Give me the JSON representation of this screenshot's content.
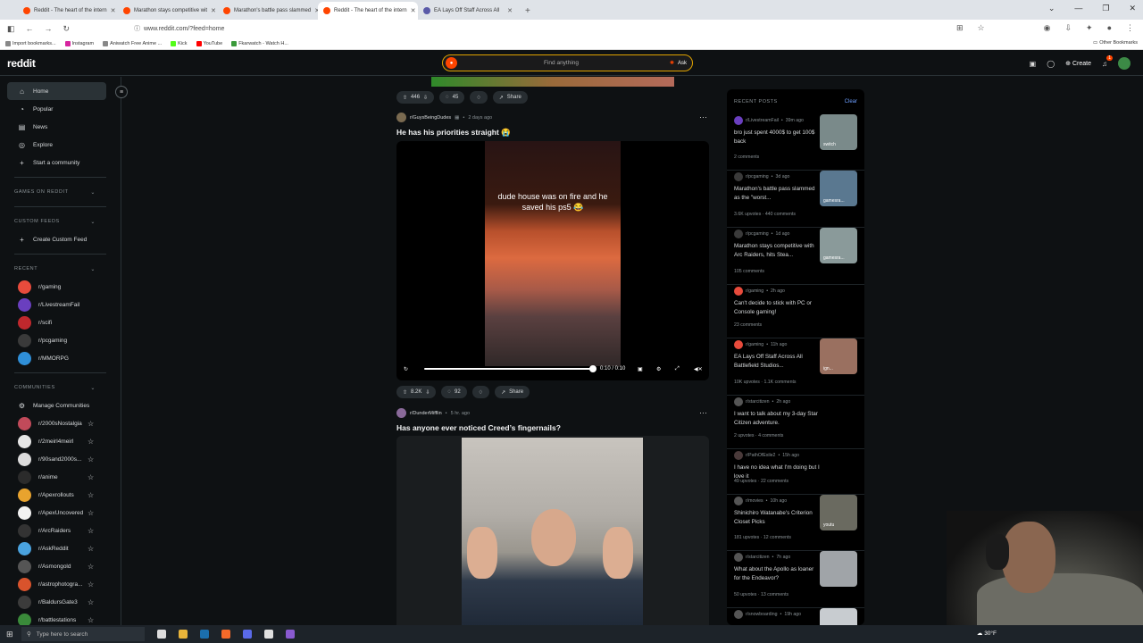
{
  "browser": {
    "tabs": [
      {
        "title": "Reddit - The heart of the intern",
        "active": false
      },
      {
        "title": "Marathon stays competitive wit",
        "active": false
      },
      {
        "title": "Marathon's battle pass slammed",
        "active": false
      },
      {
        "title": "Reddit - The heart of the intern",
        "active": true
      },
      {
        "title": "EA Lays Off Staff Across All",
        "active": false
      }
    ],
    "url_domain": "www.reddit.com",
    "url_path": "/?feed=home",
    "bookmarks": [
      "Import bookmarks...",
      "Instagram",
      "Aniwatch Free Anime ...",
      "Kick",
      "YouTube",
      "Fkarwatch - Watch H..."
    ],
    "other_bookmarks": "Other Bookmarks"
  },
  "header": {
    "logo": "reddit",
    "search_placeholder": "Find anything",
    "ask_label": "Ask",
    "create_label": "Create",
    "notif_count": "1"
  },
  "sidebar": {
    "nav": [
      {
        "label": "Home",
        "icon": "home-icon",
        "active": true
      },
      {
        "label": "Popular",
        "icon": "popular-icon"
      },
      {
        "label": "News",
        "icon": "news-icon"
      },
      {
        "label": "Explore",
        "icon": "explore-icon"
      },
      {
        "label": "Start a community",
        "icon": "plus-icon"
      }
    ],
    "games_header": "GAMES ON REDDIT",
    "custom_feeds_header": "CUSTOM FEEDS",
    "create_custom_feed": "Create Custom Feed",
    "recent_header": "RECENT",
    "recent": [
      {
        "name": "r/gaming",
        "color": "#e84b3c"
      },
      {
        "name": "r/LivestreamFail",
        "color": "#6a3fbf"
      },
      {
        "name": "r/scifi",
        "color": "#c0282d"
      },
      {
        "name": "r/pcgaming",
        "color": "#3a3a3a"
      },
      {
        "name": "r/MMORPG",
        "color": "#2f8fd8"
      }
    ],
    "communities_header": "COMMUNITIES",
    "manage_communities": "Manage Communities",
    "communities": [
      {
        "name": "r/2000sNostalgia",
        "color": "#c14a5a"
      },
      {
        "name": "r/2meirl4meirl",
        "color": "#e6e6e6"
      },
      {
        "name": "r/90sand2000s...",
        "color": "#dcdcdc"
      },
      {
        "name": "r/anime",
        "color": "#2b2b2b"
      },
      {
        "name": "r/Apexrollouts",
        "color": "#e8a32e"
      },
      {
        "name": "r/ApexUncovered",
        "color": "#f2f2f2"
      },
      {
        "name": "r/ArcRaiders",
        "color": "#333333"
      },
      {
        "name": "r/AskReddit",
        "color": "#4aa3df"
      },
      {
        "name": "r/Asmongold",
        "color": "#555555"
      },
      {
        "name": "r/astrophotogra...",
        "color": "#d9532c"
      },
      {
        "name": "r/BaldursGate3",
        "color": "#3b3b3b"
      },
      {
        "name": "r/battlestations",
        "color": "#3a8a3a"
      }
    ]
  },
  "feed": {
    "top_actions": {
      "votes": "446",
      "comments": "45",
      "share": "Share"
    },
    "post1": {
      "subreddit": "r/GuysBeingDudes",
      "time": "2 days ago",
      "title": "He has his priorities straight 😭",
      "caption": "dude house was on fire and he saved his ps5 😂",
      "time_display": "0:10 / 0:10",
      "progress": 1.0,
      "votes": "8.2K",
      "comments": "92",
      "share": "Share"
    },
    "post2": {
      "subreddit": "r/DunderMifflin",
      "time": "5 hr. ago",
      "title": "Has anyone ever noticed Creed’s fingernails?"
    }
  },
  "recent_posts": {
    "header": "RECENT POSTS",
    "clear": "Clear",
    "items": [
      {
        "sub": "r/LivestreamFail",
        "time": "39m ago",
        "title": "bro just spent 4000$ to get 100$ back",
        "stats": "2 comments",
        "thumb_label": "switch",
        "thumb": "#7a8a8a",
        "av": "#6a3fbf"
      },
      {
        "sub": "r/pcgaming",
        "time": "3d ago",
        "title": "Marathon's battle pass slammed as the \"worst...",
        "stats": "3.6K upvotes  ·  440 comments",
        "thumb_label": "gamesra...",
        "thumb": "#5a7890",
        "av": "#3a3a3a"
      },
      {
        "sub": "r/pcgaming",
        "time": "1d ago",
        "title": "Marathon stays competitive with Arc Raiders, hits Stea...",
        "stats": "105 comments",
        "thumb_label": "gamesra...",
        "thumb": "#8a9a9a",
        "av": "#3a3a3a"
      },
      {
        "sub": "r/gaming",
        "time": "2h ago",
        "title": "Can't decide to stick with PC or Console gaming!",
        "stats": "23 comments",
        "thumb_label": "",
        "thumb": "",
        "av": "#e84b3c"
      },
      {
        "sub": "r/gaming",
        "time": "11h ago",
        "title": "EA Lays Off Staff Across All Battlefield Studios...",
        "stats": "10K upvotes  ·  1.1K comments",
        "thumb_label": "ign...",
        "thumb": "#9a7060",
        "av": "#e84b3c"
      },
      {
        "sub": "r/starcitizen",
        "time": "2h ago",
        "title": "I want to talk about my 3-day Star Citizen adventure.",
        "stats": "2 upvotes  ·  4 comments",
        "thumb_label": "",
        "thumb": "",
        "av": "#555555"
      },
      {
        "sub": "r/PathOfExile2",
        "time": "15h ago",
        "title": "I have no idea what I'm doing but I love it",
        "stats": "49 upvotes  ·  22 comments",
        "thumb_label": "",
        "thumb": "",
        "av": "#4a3a3a"
      },
      {
        "sub": "r/movies",
        "time": "10h ago",
        "title": "Shinichiro Watanabe's Criterion Closet Picks",
        "stats": "181 upvotes  ·  12 comments",
        "thumb_label": "youtu",
        "thumb": "#6a6a60",
        "av": "#555555"
      },
      {
        "sub": "r/starcitizen",
        "time": "7h ago",
        "title": "What about the Apollo as loaner for the Endeavor?",
        "stats": "50 upvotes  ·  13 comments",
        "thumb_label": "",
        "thumb": "#a0a4a8",
        "av": "#555555"
      },
      {
        "sub": "r/snowboarding",
        "time": "19h ago",
        "title": "",
        "stats": "",
        "thumb_label": "",
        "thumb": "#c8ccd0",
        "av": "#555555"
      }
    ]
  },
  "taskbar": {
    "search_placeholder": "Type here to search",
    "weather": "30°F"
  }
}
